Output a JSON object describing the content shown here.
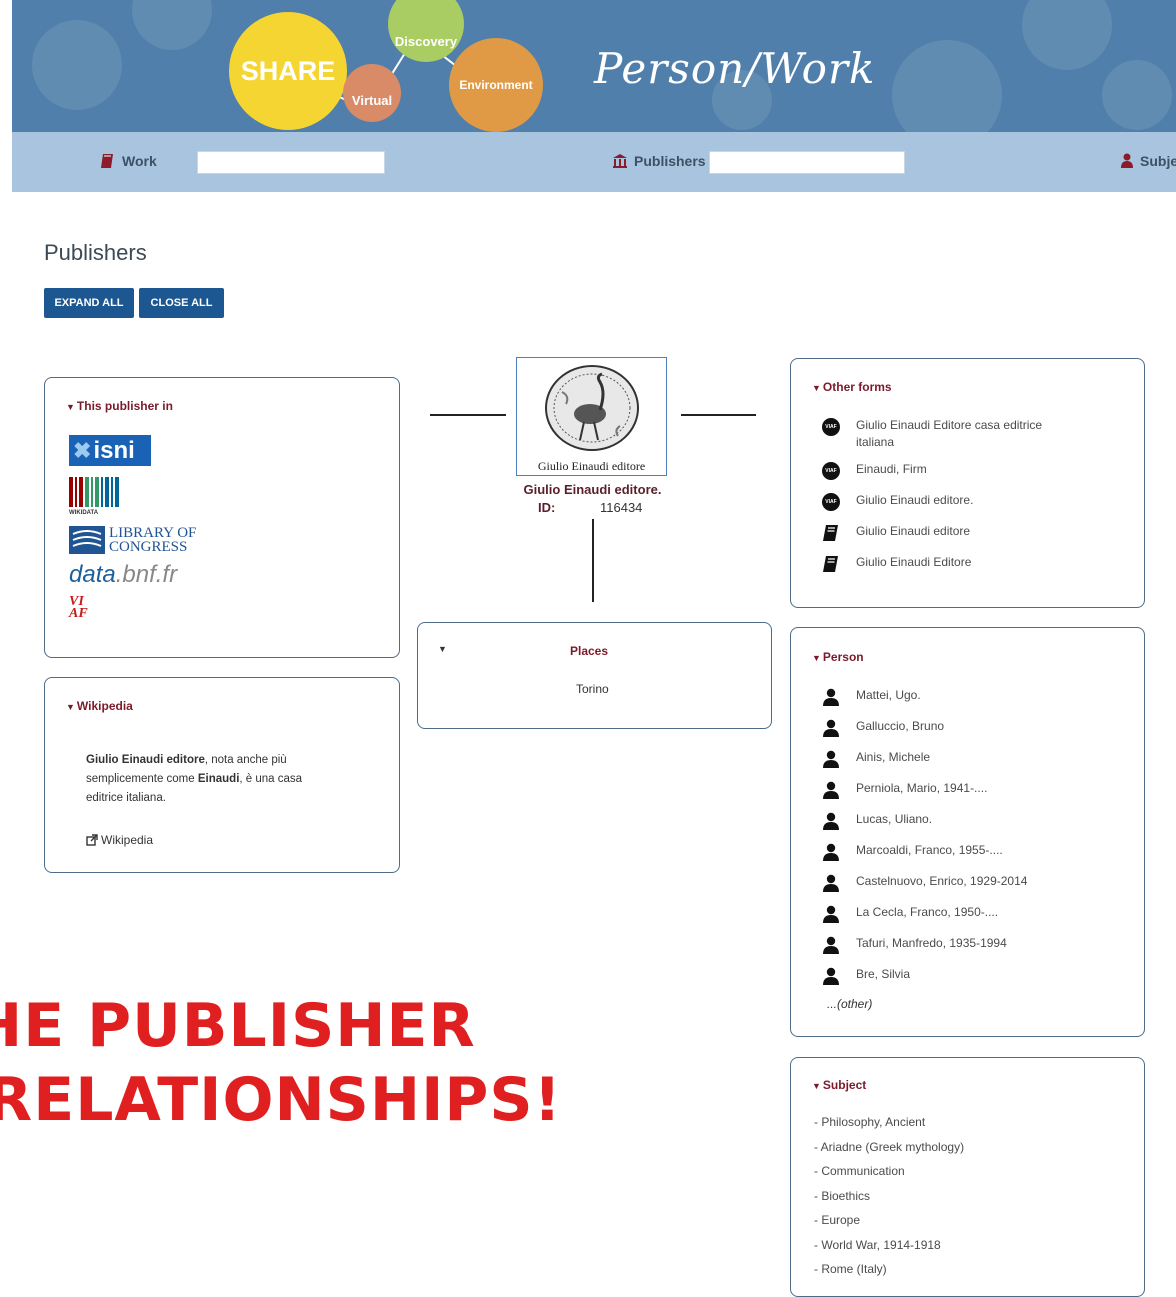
{
  "banner": {
    "bubbles": {
      "share": "SHARE",
      "virtual": "Virtual",
      "discovery": "Discovery",
      "environment": "Environment"
    },
    "title": "Person/Work",
    "colors": {
      "share": "#f5d531",
      "virtual": "#d98b68",
      "discovery": "#a9cd63",
      "environment": "#e09a45",
      "background": "#4f7faa"
    }
  },
  "searchbar": {
    "work_label": "Work",
    "publishers_label": "Publishers",
    "subject_label": "Subje",
    "work_value": "",
    "publishers_value": ""
  },
  "page": {
    "heading": "Publishers",
    "expand_all": "EXPAND ALL",
    "close_all": "CLOSE ALL"
  },
  "this_publisher_in": {
    "title": "This publisher in",
    "logos": {
      "isni": "isni",
      "wikidata": "WIKIDATA",
      "loc_line1": "LIBRARY OF",
      "loc_line2": "CONGRESS",
      "bnf_a": "data",
      "bnf_b": ".bnf.fr",
      "viaf_a": "VI",
      "viaf_b": "AF"
    }
  },
  "wikipedia": {
    "title": "Wikipedia",
    "text_bold1": "Giulio Einaudi editore",
    "text_mid": ", nota anche più semplicemente come ",
    "text_bold2": "Einaudi",
    "text_end": ", è una casa editrice italiana.",
    "link": "Wikipedia"
  },
  "publisher": {
    "image_caption": "Giulio Einaudi editore",
    "name": "Giulio Einaudi editore.",
    "id_label": "ID:",
    "id_value": "116434"
  },
  "places": {
    "title": "Places",
    "items": [
      "Torino"
    ]
  },
  "other_forms": {
    "title": "Other forms",
    "items": [
      {
        "icon": "viaf-icon",
        "text": "Giulio Einaudi Editore casa editrice italiana"
      },
      {
        "icon": "viaf-icon",
        "text": "Einaudi, Firm"
      },
      {
        "icon": "viaf-icon",
        "text": "Giulio Einaudi editore."
      },
      {
        "icon": "book-icon",
        "text": "Giulio Einaudi editore"
      },
      {
        "icon": "book-icon",
        "text": "Giulio Einaudi Editore"
      }
    ],
    "viaf_badge": "VIAF"
  },
  "person": {
    "title": "Person",
    "items": [
      "Mattei, Ugo.",
      "Galluccio, Bruno",
      "Ainis, Michele",
      "Perniola, Mario, 1941-....",
      "Lucas, Uliano.",
      "Marcoaldi, Franco, 1955-....",
      "Castelnuovo, Enrico, 1929-2014",
      "La Cecla, Franco, 1950-....",
      "Tafuri, Manfredo, 1935-1994",
      "Bre, Silvia"
    ],
    "other": "...(other)"
  },
  "subject": {
    "title": "Subject",
    "items": [
      "- Philosophy, Ancient",
      "- Ariadne (Greek mythology)",
      "- Communication",
      "- Bioethics",
      "- Europe",
      "- World War, 1914-1918",
      "- Rome (Italy)"
    ]
  },
  "caption": {
    "line1": "he Publisher",
    "line2": "Relationships!"
  }
}
